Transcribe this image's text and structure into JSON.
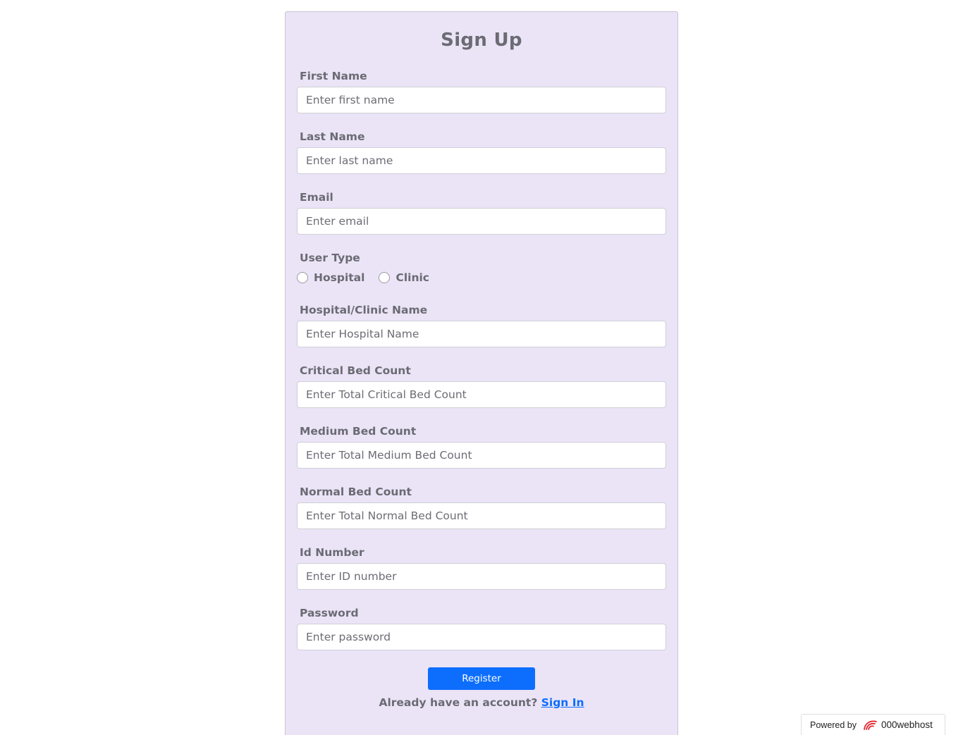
{
  "form": {
    "title": "Sign Up",
    "fields": [
      {
        "label": "First Name",
        "placeholder": "Enter first name"
      },
      {
        "label": "Last Name",
        "placeholder": "Enter last name"
      },
      {
        "label": "Email",
        "placeholder": "Enter email"
      },
      {
        "label": "Hospital/Clinic Name",
        "placeholder": "Enter Hospital Name"
      },
      {
        "label": "Critical Bed Count",
        "placeholder": "Enter Total Critical Bed Count"
      },
      {
        "label": "Medium Bed Count",
        "placeholder": "Enter Total Medium Bed Count"
      },
      {
        "label": "Normal Bed Count",
        "placeholder": "Enter Total Normal Bed Count"
      },
      {
        "label": "Id Number",
        "placeholder": "Enter ID number"
      },
      {
        "label": "Password",
        "placeholder": "Enter password"
      }
    ],
    "user_type": {
      "label": "User Type",
      "options": [
        "Hospital",
        "Clinic"
      ]
    },
    "register_label": "Register",
    "signin_prompt": "Already have an account?",
    "signin_link": "Sign In"
  },
  "badge": {
    "powered_by": "Powered by",
    "brand": "000webhost",
    "logo_icon": "000webhost-logo-icon"
  },
  "colors": {
    "card_background": "#ebe4f7",
    "button": "#0d6efd",
    "link": "#0d6efd"
  }
}
